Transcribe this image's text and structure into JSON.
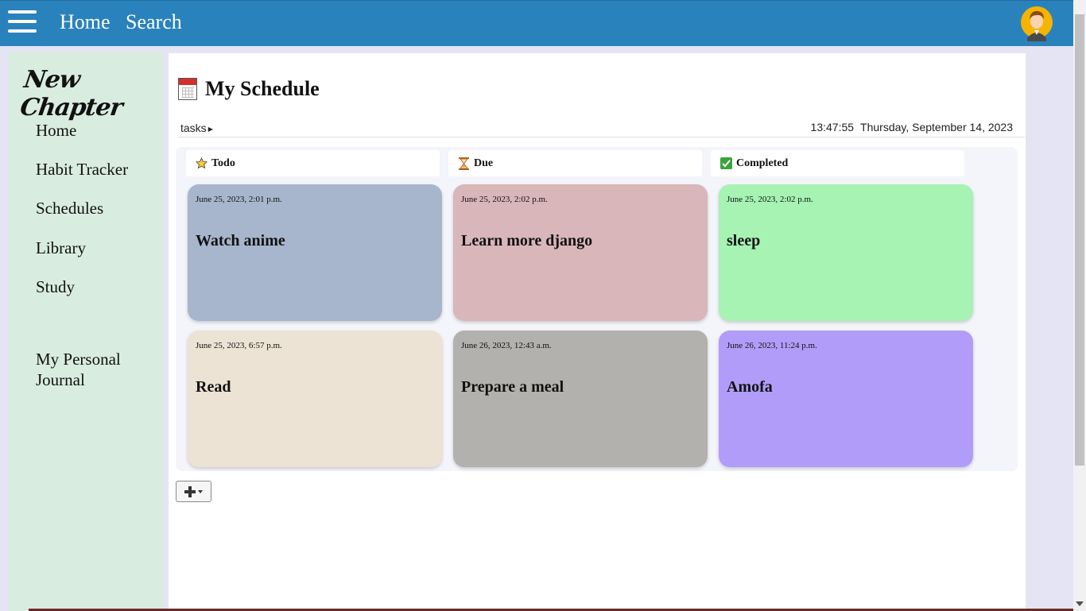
{
  "topbar": {
    "menu_icon": "hamburger-menu-icon",
    "nav": [
      "Home",
      "Search"
    ],
    "avatar_icon": "user-avatar-icon",
    "color": "#2a82bc"
  },
  "sidebar": {
    "brand": "New Chapter",
    "items": [
      {
        "label": "Home"
      },
      {
        "label": "Habit Tracker"
      },
      {
        "label": "Schedules"
      },
      {
        "label": "Library"
      },
      {
        "label": "Study"
      },
      {
        "label": "My Personal Journal"
      }
    ]
  },
  "main": {
    "title": "My Schedule",
    "title_icon": "calendar-icon",
    "crumb": "tasks",
    "time": "13:47:55",
    "date": "Thursday, September 14, 2023",
    "columns": [
      {
        "label": "Todo",
        "icon": "star-icon"
      },
      {
        "label": "Due",
        "icon": "hourglass-icon"
      },
      {
        "label": "Completed",
        "icon": "checkmark-icon"
      }
    ],
    "cards": [
      {
        "date": "June 25, 2023, 2:01 p.m.",
        "name": "Watch anime",
        "color": "#a7b6cc"
      },
      {
        "date": "June 25, 2023, 2:02 p.m.",
        "name": "Learn more django",
        "color": "#d9b6b9"
      },
      {
        "date": "June 25, 2023, 2:02 p.m.",
        "name": "sleep",
        "color": "#a6f3b3"
      },
      {
        "date": "June 25, 2023, 6:57 p.m.",
        "name": "Read",
        "color": "#ece3d4"
      },
      {
        "date": "June 26, 2023, 12:43 a.m.",
        "name": "Prepare a meal",
        "color": "#b3b1ad"
      },
      {
        "date": "June 26, 2023, 11:24 p.m.",
        "name": "Amofa",
        "color": "#b19df9"
      }
    ],
    "add_icon": "plus-dropdown-icon"
  }
}
